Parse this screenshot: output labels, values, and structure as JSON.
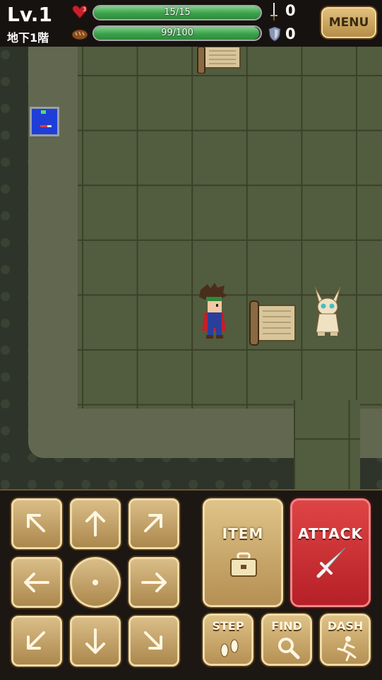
{
  "hud": {
    "level": "Lv.1",
    "floor": "地下1階",
    "hp_text": "15/15",
    "hp_fraction": 1.0,
    "satiety_text": "99/100",
    "satiety_fraction": 0.99,
    "heart_badge": "3",
    "attack_value": "0",
    "defense_value": "0",
    "menu_label": "MENU"
  },
  "actions": {
    "item_label": "ITEM",
    "attack_label": "ATTACK",
    "step_label": "STEP",
    "find_label": "FIND",
    "dash_label": "DASH"
  },
  "dpad": [
    "up-left",
    "up",
    "up-right",
    "left",
    "wait",
    "right",
    "down-left",
    "down",
    "down-right"
  ],
  "colors": {
    "gauge_green": "#3aa14a",
    "attack_red": "#c62a30",
    "button_gold": "#c9a66a"
  }
}
